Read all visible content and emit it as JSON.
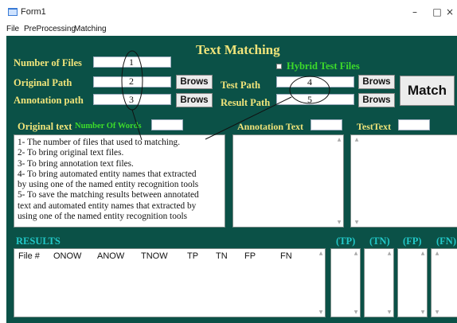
{
  "window": {
    "title": "Form1",
    "minimize": "–",
    "maximize": "□",
    "close": "×"
  },
  "menu": [
    "File",
    "PreProcessing",
    "Matching"
  ],
  "heading": "Text Matching",
  "labels": {
    "num_files": "Number of Files",
    "original_path": "Original Path",
    "annotation_path": "Annotation path",
    "test_path": "Test Path",
    "result_path": "Result Path",
    "hybrid": "Hybrid Test Files",
    "original_text": "Original text",
    "num_words": "Number Of Words",
    "annotation_text": "Annotation Text",
    "test_text": "TestText",
    "results": "RESULTS",
    "tp": "(TP)",
    "tn": "(TN)",
    "fp": "(FP)",
    "fn": "(FN)"
  },
  "buttons": {
    "browse": "Brows",
    "match": "Match"
  },
  "callouts": [
    "1",
    "2",
    "3",
    "4",
    "5"
  ],
  "original_text_lines": [
    "1- The number of files that used to matching.",
    "2- To bring original text files.",
    "3- To bring annotation text files.",
    "4- To bring automated entity names that extracted",
    "by using one of the named entity recognition tools",
    "5- To save the matching results between annotated",
    "text and automated entity names that extracted by",
    "using one of the named entity recognition tools"
  ],
  "results_columns": [
    "File #",
    "ONOW",
    "ANOW",
    "TNOW",
    "TP",
    "TN",
    "FP",
    "FN"
  ],
  "colors": {
    "background": "#0b5147",
    "label_yellow": "#f0e47a",
    "label_green": "#3ddc2a",
    "label_cyan": "#22c9c9"
  }
}
